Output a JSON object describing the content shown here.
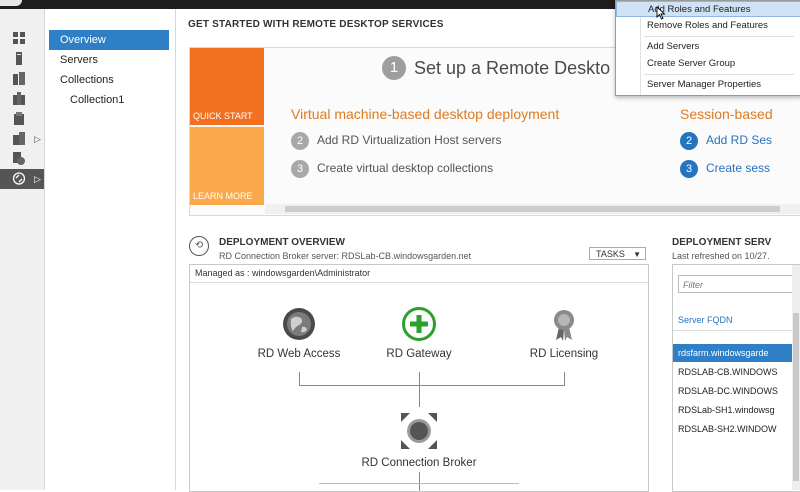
{
  "window": {
    "title": ""
  },
  "left_rail": {
    "items": [
      {
        "icon": "dashboard-icon"
      },
      {
        "icon": "local-server-icon"
      },
      {
        "icon": "all-servers-icon"
      },
      {
        "icon": "ad-ds-icon"
      },
      {
        "icon": "new-role-icon"
      },
      {
        "icon": "file-storage-icon"
      },
      {
        "icon": "iis-icon"
      },
      {
        "icon": "remote-desktop-services-icon"
      }
    ]
  },
  "nav": {
    "items": [
      {
        "label": "Overview",
        "active": true
      },
      {
        "label": "Servers"
      },
      {
        "label": "Collections"
      },
      {
        "label": "Collection1"
      }
    ]
  },
  "get_started": {
    "title": "GET STARTED WITH REMOTE DESKTOP SERVICES",
    "quick_start": "QUICK START",
    "learn_more": "LEARN MORE",
    "step1": {
      "num": "1",
      "text": "Set up a Remote Deskto"
    },
    "vm": {
      "title": "Virtual machine-based desktop deployment",
      "steps": [
        {
          "num": "2",
          "text": "Add RD Virtualization Host servers"
        },
        {
          "num": "3",
          "text": "Create virtual desktop collections"
        }
      ]
    },
    "session": {
      "title": "Session-based",
      "steps": [
        {
          "num": "2",
          "text": "Add RD Ses"
        },
        {
          "num": "3",
          "text": "Create sess"
        }
      ]
    }
  },
  "deployment": {
    "title": "DEPLOYMENT OVERVIEW",
    "subtitle": "RD Connection Broker server: RDSLab-CB.windowsgarden.net",
    "tasks": "TASKS",
    "managed_as": "Managed as : windowsgarden\\Administrator",
    "roles": {
      "web_access": "RD Web Access",
      "gateway": "RD Gateway",
      "licensing": "RD Licensing",
      "broker": "RD Connection Broker"
    }
  },
  "servers": {
    "title": "DEPLOYMENT SERV",
    "subtitle": "Last refreshed on 10/27.",
    "filter_placeholder": "Filter",
    "column": "Server FQDN",
    "rows": [
      {
        "name": "rdsfarm.windowsgarde",
        "selected": true
      },
      {
        "name": "RDSLAB-CB.WINDOWS"
      },
      {
        "name": "RDSLAB-DC.WINDOWS"
      },
      {
        "name": "RDSLab-SH1.windowsg"
      },
      {
        "name": "RDSLAB-SH2.WINDOW"
      }
    ]
  },
  "context_menu": {
    "items": [
      {
        "label": "Add Roles and Features",
        "highlighted": true
      },
      {
        "label": "Remove Roles and Features"
      },
      {
        "label": "Add Servers"
      },
      {
        "label": "Create Server Group"
      },
      {
        "label": "Server Manager Properties"
      }
    ]
  },
  "colors": {
    "accent_blue": "#2f7fc7",
    "quick_start_orange": "#f2701f",
    "learn_more_orange": "#f9a84c",
    "heading_orange": "#e07a1f",
    "gateway_green": "#2aa12a"
  }
}
